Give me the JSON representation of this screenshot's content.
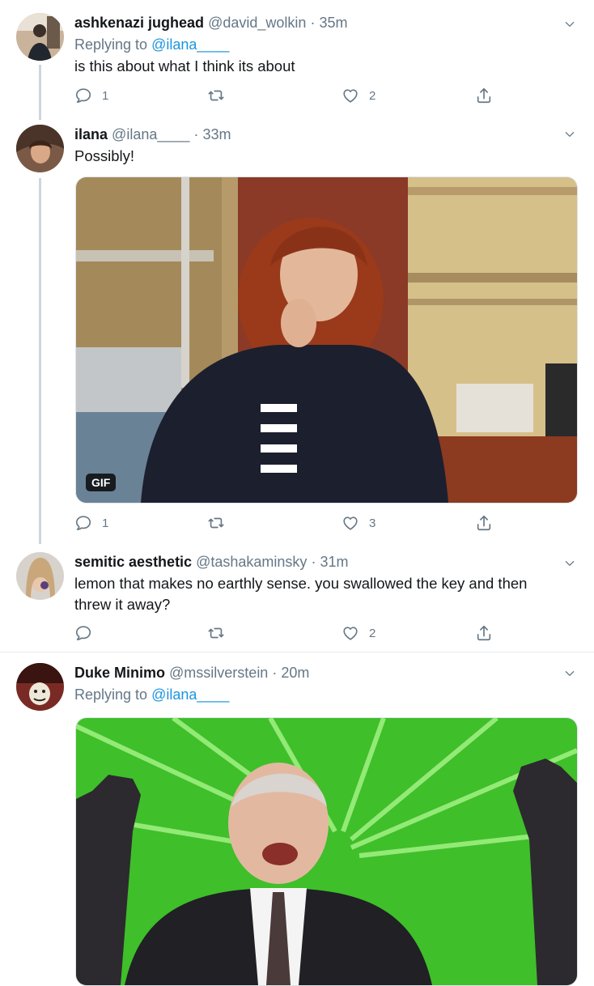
{
  "tweets": [
    {
      "name": "ashkenazi jughead",
      "handle": "@david_wolkin",
      "time": "35m",
      "reply_prefix": "Replying to",
      "reply_to": "@ilana____",
      "text": "is this about what I think its about",
      "replies": "1",
      "retweets": "",
      "likes": "2"
    },
    {
      "name": "ilana",
      "handle": "@ilana____",
      "time": "33m",
      "text": "Possibly!",
      "media_badge": "GIF",
      "replies": "1",
      "retweets": "",
      "likes": "3"
    },
    {
      "name": "semitic aesthetic",
      "handle": "@tashakaminsky",
      "time": "31m",
      "text": "lemon that makes no earthly sense. you swallowed the key and then threw it away?",
      "replies": "",
      "retweets": "",
      "likes": "2"
    },
    {
      "name": "Duke Minimo",
      "handle": "@mssilverstein",
      "time": "20m",
      "reply_prefix": "Replying to",
      "reply_to": "@ilana____"
    }
  ],
  "separator": "·",
  "icons": {
    "reply": "reply-icon",
    "retweet": "retweet-icon",
    "like": "heart-icon",
    "share": "share-icon",
    "more": "chevron-down-icon"
  },
  "colors": {
    "link": "#1b95e0",
    "muted": "#657786",
    "thread_line": "#ccd6dd"
  }
}
